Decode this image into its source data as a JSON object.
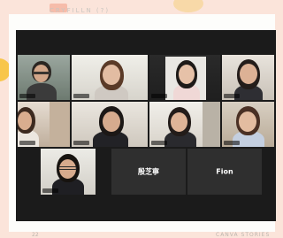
{
  "header": {
    "label": "CRYFILLN (?)"
  },
  "footer": {
    "page_number": "22",
    "brand": "CANVA STORIES"
  },
  "meeting": {
    "name_tiles": [
      {
        "name": "殷芝寧"
      },
      {
        "name": "Fion"
      }
    ]
  },
  "colors": {
    "background": "#fbe4da",
    "screen": "#1b1b1b",
    "active_speaker_border": "#e5e55a"
  }
}
